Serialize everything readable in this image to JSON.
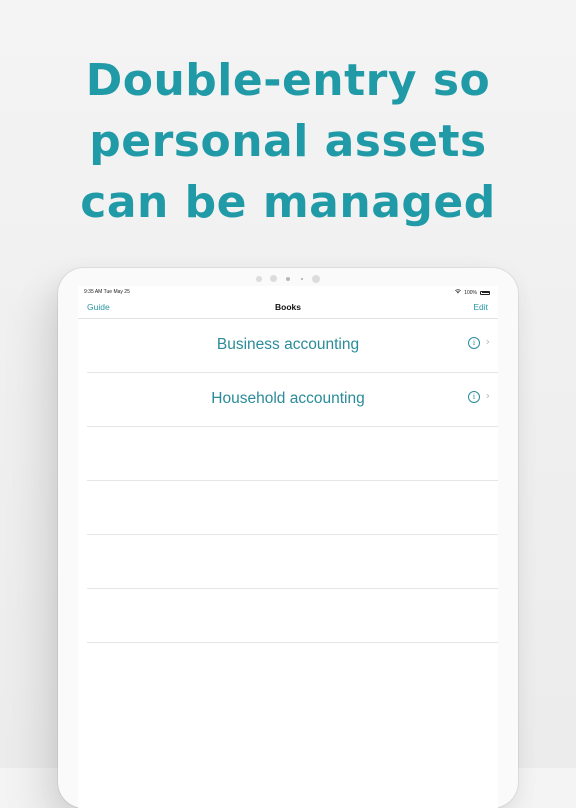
{
  "headline": {
    "line1": "Double-entry so",
    "line2": "personal assets",
    "line3": "can be managed"
  },
  "status_bar": {
    "time": "9:35 AM  Tue May 25",
    "battery": "100%"
  },
  "nav": {
    "left_label": "Guide",
    "title": "Books",
    "right_label": "Edit"
  },
  "books": [
    {
      "label": "Business accounting",
      "info": "i",
      "chevron": "›"
    },
    {
      "label": "Household accounting",
      "info": "i",
      "chevron": "›"
    }
  ],
  "colors": {
    "accent": "#1f9aa6",
    "cell_text": "#2a8b99"
  },
  "icons": [
    "info-icon",
    "chevron-right-icon",
    "wifi-icon",
    "battery-icon"
  ]
}
